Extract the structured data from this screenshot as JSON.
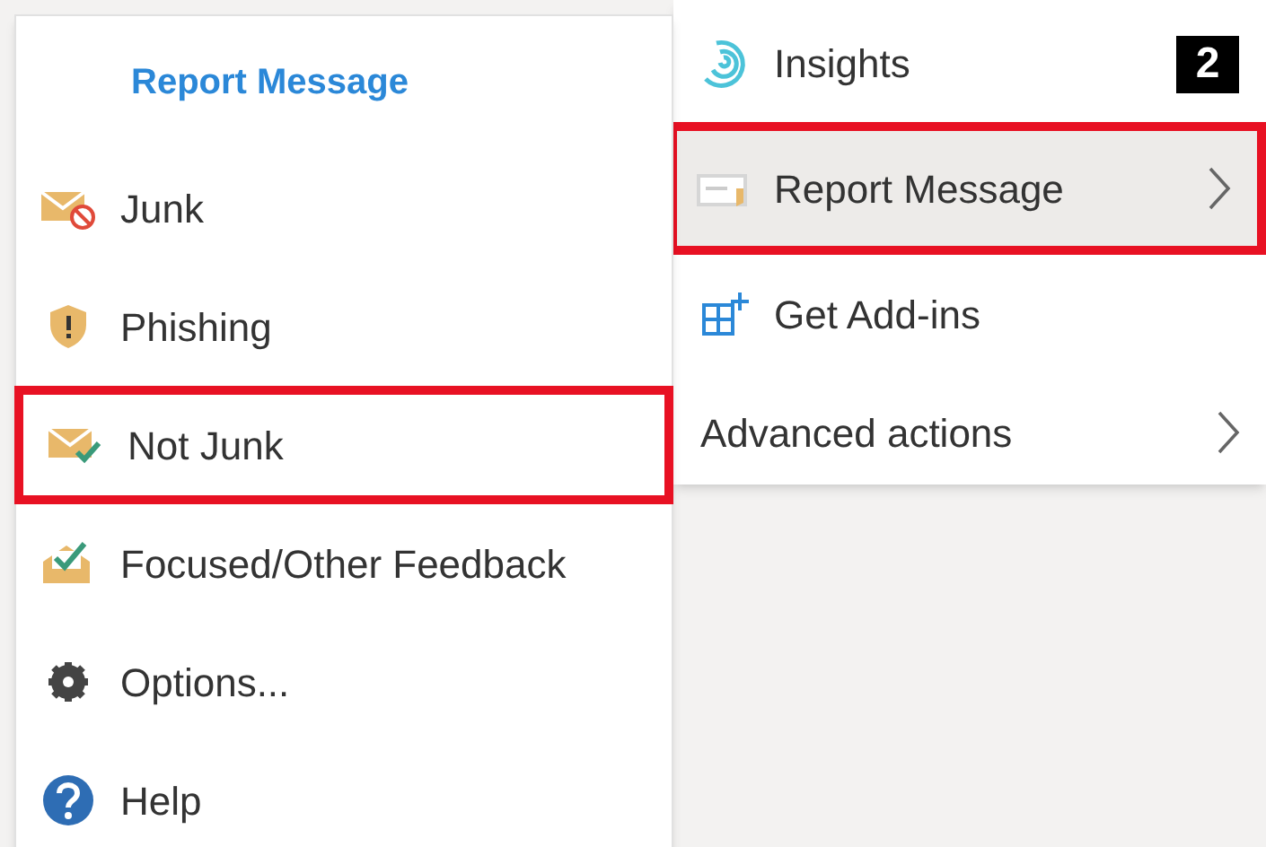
{
  "submenu": {
    "title": "Report Message",
    "items": [
      {
        "kind": "junk",
        "label": "Junk",
        "outlined": false
      },
      {
        "kind": "phishing",
        "label": "Phishing",
        "outlined": false
      },
      {
        "kind": "not-junk",
        "label": "Not Junk",
        "outlined": true
      },
      {
        "kind": "feedback",
        "label": "Focused/Other Feedback",
        "outlined": false
      },
      {
        "kind": "options",
        "label": "Options...",
        "outlined": false
      },
      {
        "kind": "help",
        "label": "Help",
        "outlined": false
      }
    ]
  },
  "menu": {
    "items": [
      {
        "kind": "insights",
        "label": "Insights",
        "has_submenu": false,
        "selected": false,
        "outlined": false
      },
      {
        "kind": "report",
        "label": "Report Message",
        "has_submenu": true,
        "selected": true,
        "outlined": true
      },
      {
        "kind": "add-ins",
        "label": "Get Add-ins",
        "has_submenu": false,
        "selected": false,
        "outlined": false
      },
      {
        "kind": "none",
        "label": "Advanced actions",
        "has_submenu": true,
        "selected": false,
        "outlined": false
      }
    ]
  },
  "step_badge": "2"
}
